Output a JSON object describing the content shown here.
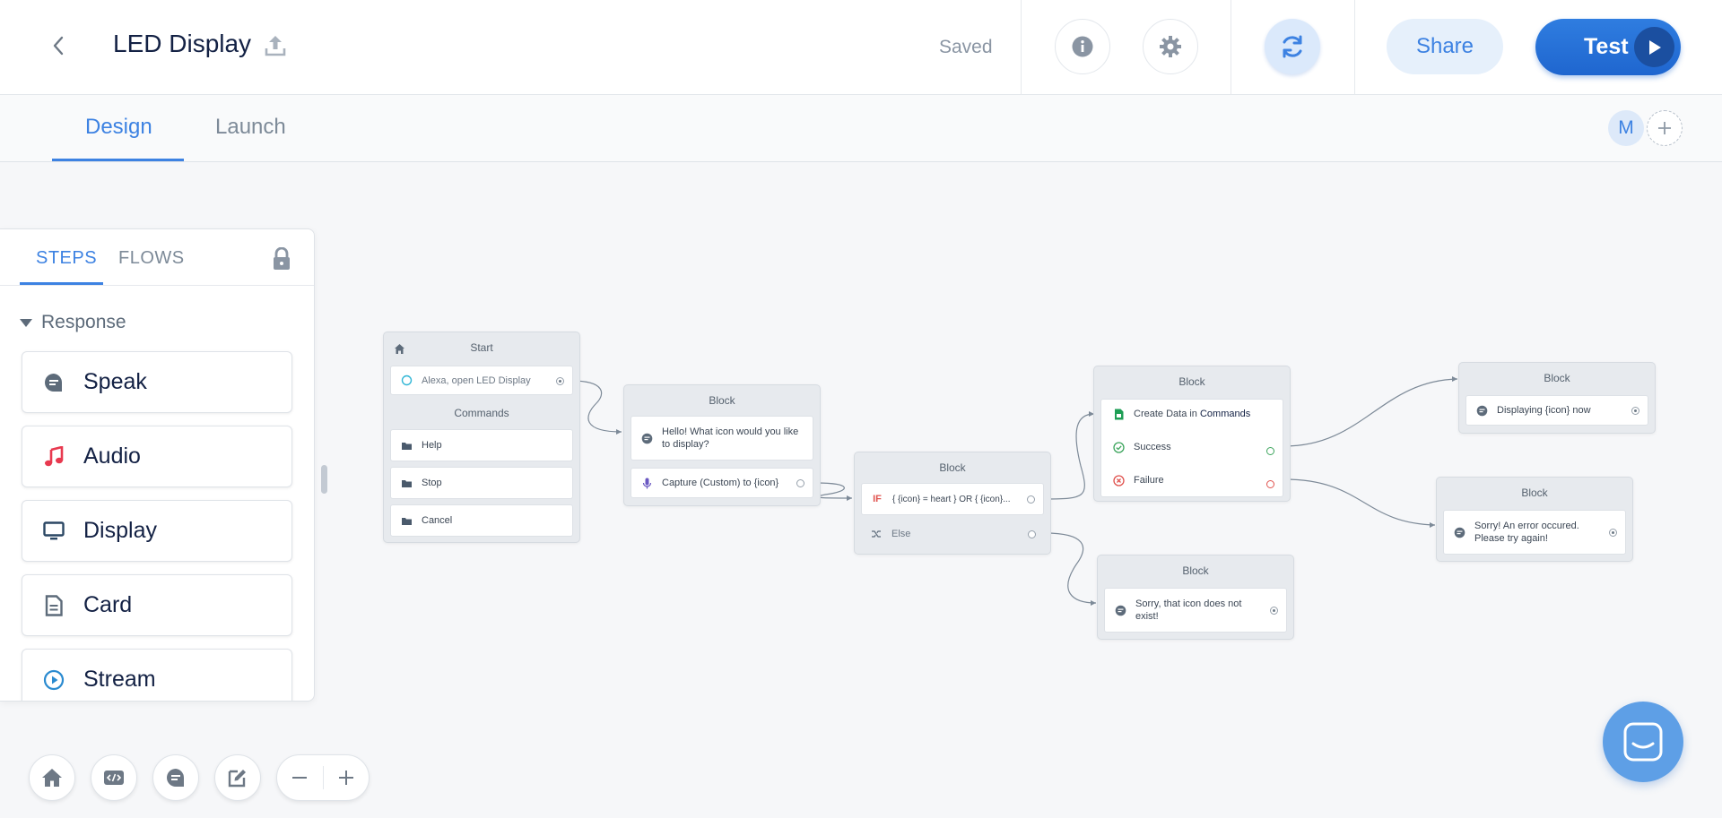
{
  "header": {
    "title": "LED Display",
    "status": "Saved",
    "share_label": "Share",
    "test_label": "Test"
  },
  "tabs": {
    "design": "Design",
    "launch": "Launch"
  },
  "collaborators": {
    "avatar_initial": "M"
  },
  "steps_panel": {
    "tab_steps": "STEPS",
    "tab_flows": "FLOWS",
    "section": "Response",
    "items": [
      {
        "label": "Speak",
        "icon": "speak-icon"
      },
      {
        "label": "Audio",
        "icon": "music-note-icon"
      },
      {
        "label": "Display",
        "icon": "monitor-icon"
      },
      {
        "label": "Card",
        "icon": "document-icon"
      },
      {
        "label": "Stream",
        "icon": "play-circle-icon"
      }
    ]
  },
  "canvas": {
    "start_block": {
      "title": "Start",
      "launch_row": "Alexa, open LED Display",
      "commands_title": "Commands",
      "commands": [
        "Help",
        "Stop",
        "Cancel"
      ]
    },
    "block_speak_question": {
      "title": "Block",
      "speak_line1": "Hello! What icon would you like",
      "speak_line2": "to display?",
      "capture": "Capture (Custom) to {icon}"
    },
    "block_if": {
      "title": "Block",
      "if_keyword": "IF",
      "condition": "{ {icon} = heart } OR { {icon}...",
      "else_label": "Else"
    },
    "block_create_data": {
      "title": "Block",
      "create_prefix": "Create Data in ",
      "create_target": "Commands",
      "success": "Success",
      "failure": "Failure"
    },
    "block_displaying": {
      "title": "Block",
      "speak": "Displaying {icon} now"
    },
    "block_error": {
      "title": "Block",
      "line1": "Sorry! An error occured.",
      "line2": "Please try again!"
    },
    "block_not_exist": {
      "title": "Block",
      "line1": "Sorry, that icon does not",
      "line2": "exist!"
    }
  },
  "colors": {
    "accent": "#3d82e2",
    "test_button": "#1f66cf",
    "success": "#3da55d",
    "failure": "#e0534f",
    "if_red": "#e0534f",
    "audio_red": "#e8394f",
    "sheet_green": "#1e9e55"
  }
}
